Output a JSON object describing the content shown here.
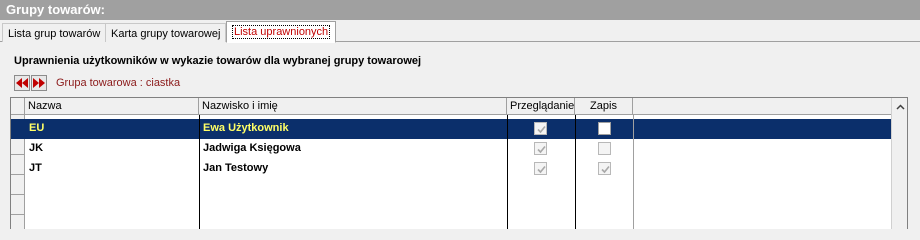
{
  "window": {
    "title": "Grupy towarów:"
  },
  "tabs": [
    {
      "label": "Lista grup towarów",
      "active": false
    },
    {
      "label": "Karta grupy towarowej",
      "active": false
    },
    {
      "label": "Lista uprawnionych",
      "active": true
    }
  ],
  "heading": "Uprawnienia użytkowników w wykazie towarów dla wybranej grupy towarowej",
  "nav": {
    "prev_icon": "double-left-arrow-icon",
    "next_icon": "double-right-arrow-icon",
    "group_label": "Grupa towarowa : ciastka"
  },
  "grid": {
    "columns": [
      "Nazwa",
      "Nazwisko i imię",
      "Przeglądanie",
      "Zapis"
    ],
    "rows": [
      {
        "name": "EU",
        "fullname": "Ewa Użytkownik",
        "browse": true,
        "browse_enabled": false,
        "write": false,
        "write_enabled": true,
        "selected": true
      },
      {
        "name": "JK",
        "fullname": "Jadwiga Księgowa",
        "browse": true,
        "browse_enabled": false,
        "write": false,
        "write_enabled": false,
        "selected": false
      },
      {
        "name": "JT",
        "fullname": "Jan Testowy",
        "browse": true,
        "browse_enabled": false,
        "write": true,
        "write_enabled": false,
        "selected": false
      }
    ]
  },
  "colors": {
    "selection": "#0b2f6b",
    "selection_name_text": "#ffff66",
    "group_label": "#8b1a1a",
    "active_tab_text": "#c00000"
  }
}
